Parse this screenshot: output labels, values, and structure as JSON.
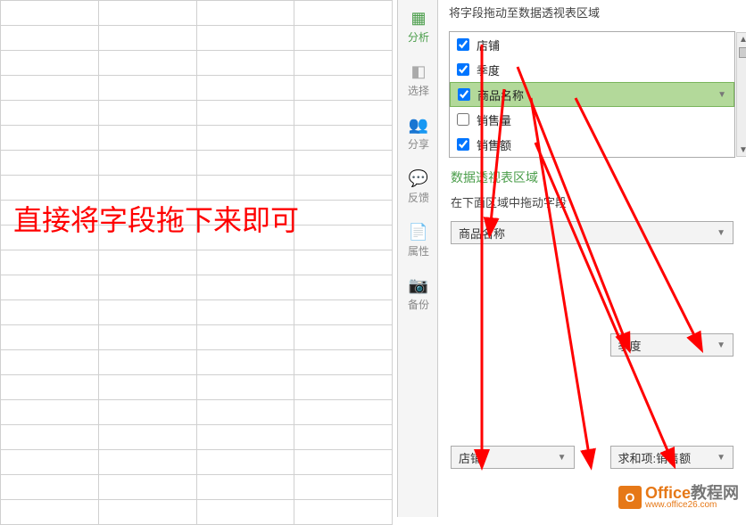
{
  "annotation": "直接将字段拖下来即可",
  "side_toolbar": {
    "analyze": "分析",
    "select": "选择",
    "share": "分享",
    "feedback": "反馈",
    "properties": "属性",
    "backup": "备份"
  },
  "panel": {
    "header": "将字段拖动至数据透视表区域",
    "fields": [
      {
        "label": "店铺",
        "checked": true,
        "selected": false
      },
      {
        "label": "季度",
        "checked": true,
        "selected": false
      },
      {
        "label": "商品名称",
        "checked": true,
        "selected": true
      },
      {
        "label": "销售量",
        "checked": false,
        "selected": false
      },
      {
        "label": "销售额",
        "checked": true,
        "selected": false
      }
    ],
    "section_title": "数据透视表区域",
    "sub_label": "在下面区域中拖动字段",
    "zone_filter": {
      "label": "商品名称"
    },
    "zone_column": {
      "label": "季度"
    },
    "zone_row": {
      "label": "店铺"
    },
    "zone_value": {
      "label": "求和项:销售额"
    }
  },
  "watermark": {
    "badge": "O",
    "main_a": "Office",
    "main_b": "教程网",
    "url": "www.office26.com"
  }
}
